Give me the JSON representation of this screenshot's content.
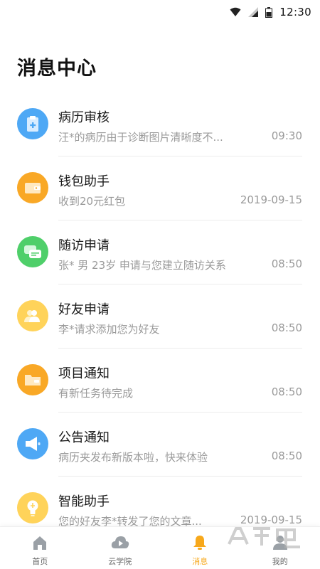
{
  "status_bar": {
    "time": "12:30"
  },
  "page_title": "消息中心",
  "messages": [
    {
      "title": "病历审核",
      "preview": "汪*的病历由于诊断图片清晰度不...",
      "time": "09:30",
      "icon": "clipboard-icon",
      "color": "#4ea8f5"
    },
    {
      "title": "钱包助手",
      "preview": "收到20元红包",
      "time": "2019-09-15",
      "icon": "wallet-icon",
      "color": "#f9a826"
    },
    {
      "title": "随访申请",
      "preview": "张* 男 23岁 申请与您建立随访关系",
      "time": "08:50",
      "icon": "chat-icon",
      "color": "#4fcf6a"
    },
    {
      "title": "好友申请",
      "preview": "李*请求添加您为好友",
      "time": "08:50",
      "icon": "users-icon",
      "color": "#ffd35a"
    },
    {
      "title": "项目通知",
      "preview": "有新任务待完成",
      "time": "08:50",
      "icon": "folder-icon",
      "color": "#f9a826"
    },
    {
      "title": "公告通知",
      "preview": "病历夹发布新版本啦，快来体验",
      "time": "08:50",
      "icon": "megaphone-icon",
      "color": "#4ea8f5"
    },
    {
      "title": "智能助手",
      "preview": "您的好友李*转发了您的文章...",
      "time": "2019-09-15",
      "icon": "bulb-icon",
      "color": "#ffd35a"
    }
  ],
  "tabs": [
    {
      "label": "首页",
      "icon": "home-icon",
      "active": false
    },
    {
      "label": "云学院",
      "icon": "cloud-play-icon",
      "active": false
    },
    {
      "label": "消息",
      "icon": "bell-icon",
      "active": true
    },
    {
      "label": "我的",
      "icon": "user-icon",
      "active": false
    }
  ],
  "colors": {
    "accent": "#f7a81b",
    "muted_text": "#9a9a9a",
    "divider": "#ececec"
  },
  "watermark": "安卓吧"
}
